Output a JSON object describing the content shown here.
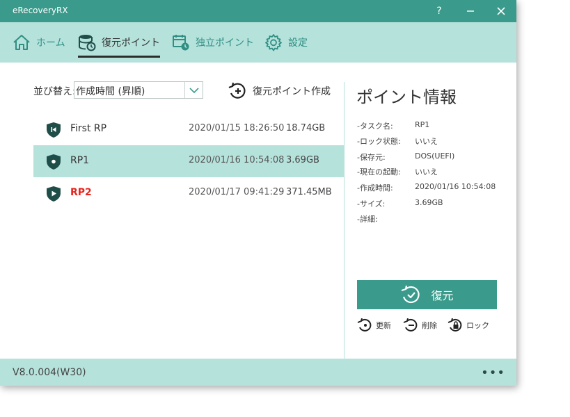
{
  "window": {
    "title": "eRecoveryRX",
    "help_label": "?",
    "minimize_label": "—",
    "close_label": "✕"
  },
  "nav": {
    "tabs": [
      {
        "label": "ホーム",
        "icon": "home-icon"
      },
      {
        "label": "復元ポイント",
        "icon": "database-restore-icon",
        "active": true
      },
      {
        "label": "独立ポイント",
        "icon": "calendar-clock-icon"
      },
      {
        "label": "設定",
        "icon": "gear-icon"
      }
    ]
  },
  "list": {
    "sort_label": "並び替え:",
    "sort_value": "作成時間 (昇順)",
    "create_label": "復元ポイント作成",
    "rows": [
      {
        "name": "First RP",
        "date": "2020/01/15 18:26:50",
        "size": "18.74GB",
        "icon": "shield-first-icon"
      },
      {
        "name": "RP1",
        "date": "2020/01/16 10:54:08",
        "size": "3.69GB",
        "icon": "shield-dot-icon",
        "selected": true
      },
      {
        "name": "RP2",
        "date": "2020/01/17 09:41:29",
        "size": "371.45MB",
        "icon": "shield-play-icon",
        "highlight": true
      }
    ]
  },
  "info": {
    "title": "ポイント情報",
    "rows": [
      {
        "key": "-タスク名:",
        "value": "RP1"
      },
      {
        "key": "-ロック状態:",
        "value": "いいえ"
      },
      {
        "key": "-保存元:",
        "value": "DOS(UEFI)"
      },
      {
        "key": "-現在の起動:",
        "value": "いいえ"
      },
      {
        "key": "-作成時間:",
        "value": "2020/01/16 10:54:08"
      },
      {
        "key": "-サイズ:",
        "value": "3.69GB"
      },
      {
        "key": "-詳細:",
        "value": ""
      }
    ],
    "restore_label": "復元",
    "refresh_label": "更新",
    "delete_label": "削除",
    "lock_label": "ロック"
  },
  "footer": {
    "version": "V8.0.004(W30)",
    "more_label": "•••"
  },
  "colors": {
    "accent": "#3a9a8b",
    "light_accent": "#b6e2dc",
    "icon_dark": "#1f4d48",
    "red": "#e8241c"
  }
}
